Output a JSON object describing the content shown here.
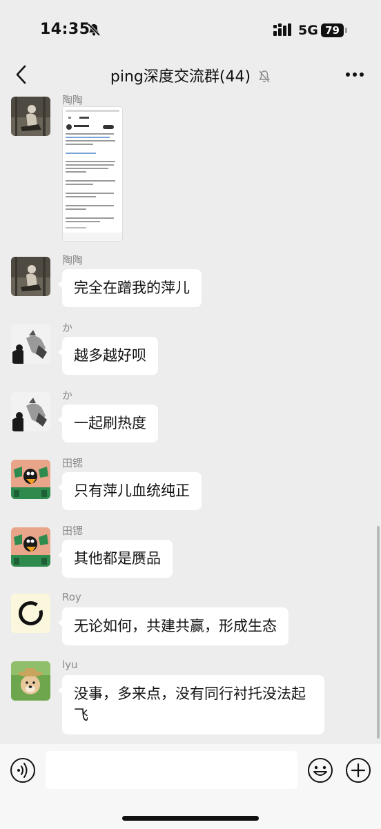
{
  "status_bar": {
    "time": "14:35",
    "network": "5G",
    "battery": "79"
  },
  "header": {
    "title": "ping深度交流群(44)"
  },
  "messages": [
    {
      "sender": "陶陶",
      "type": "image",
      "avatar": "taotao"
    },
    {
      "sender": "陶陶",
      "text": "完全在蹭我的萍儿",
      "avatar": "taotao"
    },
    {
      "sender": "か",
      "text": "越多越好呗",
      "avatar": "ka"
    },
    {
      "sender": "か",
      "text": "一起刷热度",
      "avatar": "ka"
    },
    {
      "sender": "田锶",
      "text": "只有萍儿血统纯正",
      "avatar": "tiansi"
    },
    {
      "sender": "田锶",
      "text": "其他都是赝品",
      "avatar": "tiansi"
    },
    {
      "sender": "Roy",
      "text": "无论如何，共建共赢，形成生态",
      "avatar": "roy"
    },
    {
      "sender": "lyu",
      "text": "没事，多来点，没有同行衬托没法起飞",
      "avatar": "lyu"
    }
  ],
  "input": {
    "placeholder": ""
  },
  "icons": [
    "bell-off-icon",
    "signal-icon",
    "back-icon",
    "mute-icon",
    "more-icon",
    "voice-icon",
    "emoji-icon",
    "plus-icon"
  ]
}
